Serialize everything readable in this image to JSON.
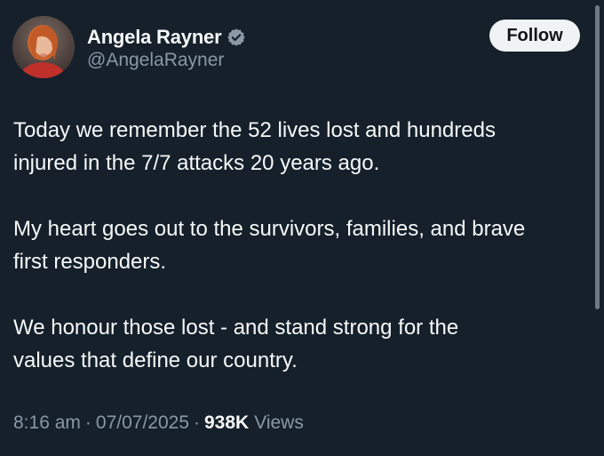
{
  "author": {
    "display_name": "Angela Rayner",
    "handle": "@AngelaRayner",
    "verified_icon": "verified-badge-icon",
    "avatar_icon": "profile-photo"
  },
  "follow_button": {
    "label": "Follow"
  },
  "tweet": {
    "lines": [
      "Today we remember the 52 lives lost and hundreds",
      "injured in the 7/7 attacks 20 years ago.",
      "My heart goes out to the survivors, families, and brave",
      "first responders.",
      "We honour those lost - and stand strong for the",
      "values that define our country."
    ]
  },
  "meta": {
    "time": "8:16 am",
    "separator": "·",
    "date": "07/07/2025",
    "views_count": "938K",
    "views_label": "Views"
  },
  "colors": {
    "background": "#15202b",
    "text_primary": "#f7f9f9",
    "text_secondary": "#8b98a5",
    "button_bg": "#eff3f4",
    "verified_badge": "#8b98a5"
  }
}
